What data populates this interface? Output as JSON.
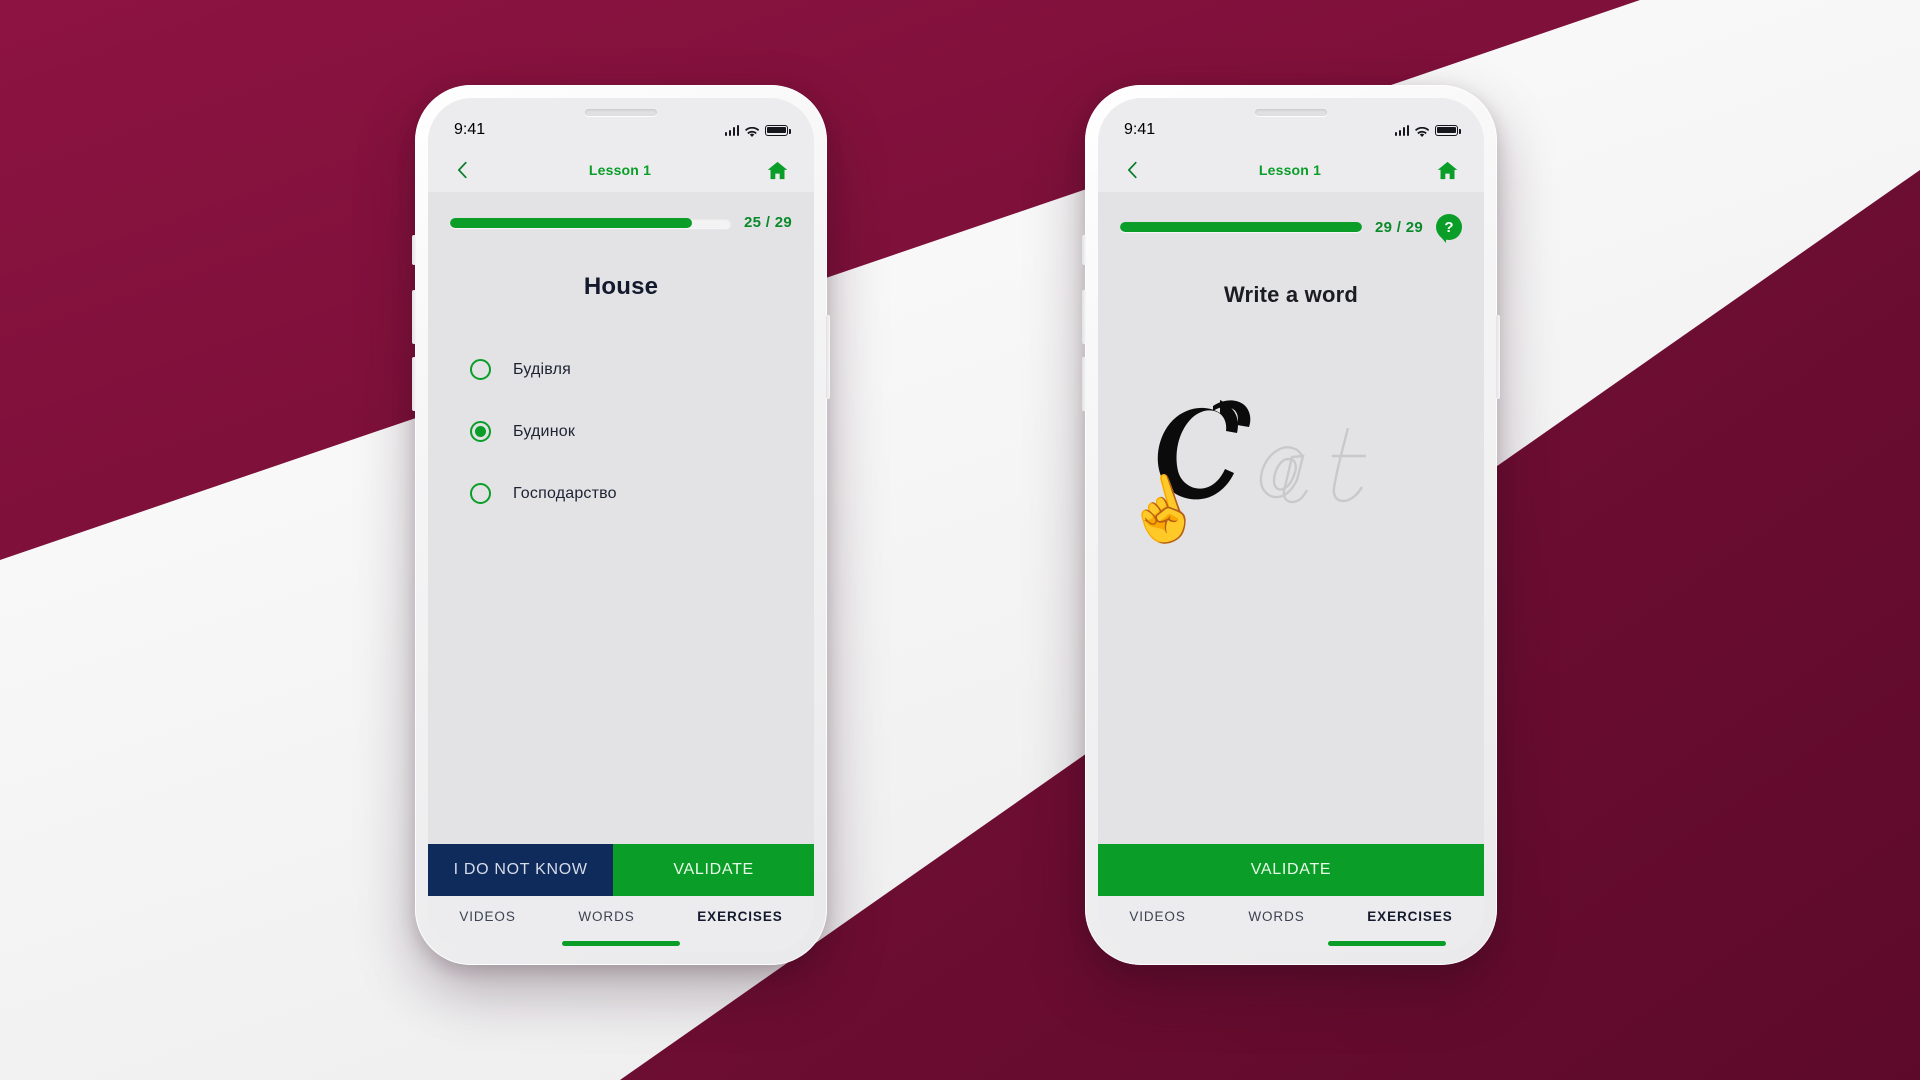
{
  "background": {
    "maroon": "#7c1039",
    "maroon_dark": "#6d0f33",
    "white": "#ffffff"
  },
  "theme": {
    "green": "#0a9e28",
    "green_text": "#0a8a2a",
    "navy": "#0f2b5b",
    "ink": "#141a2e",
    "screen_bg": "#e3e3e5",
    "chrome_bg": "#ececee"
  },
  "phones": [
    {
      "id": "phone-1",
      "status": {
        "time": "9:41",
        "signal_icon": "signal-bars-icon",
        "wifi_icon": "wifi-icon",
        "battery_icon": "battery-icon"
      },
      "nav": {
        "back_icon": "chevron-left-icon",
        "title": "Lesson 1",
        "home_icon": "home-icon"
      },
      "progress": {
        "current": 25,
        "total": 29,
        "label": "25 / 29",
        "percent": 86,
        "has_help": false
      },
      "prompt": "House",
      "prompt_style": "bold",
      "options": [
        {
          "label": "Будівля",
          "selected": false
        },
        {
          "label": "Будинок",
          "selected": true
        },
        {
          "label": "Господарство",
          "selected": false
        }
      ],
      "actions": [
        {
          "label": "I DO NOT KNOW",
          "style": "dark"
        },
        {
          "label": "VALIDATE",
          "style": "green"
        }
      ],
      "tabs": [
        {
          "label": "VIDEOS",
          "active": false
        },
        {
          "label": "WORDS",
          "active": false
        },
        {
          "label": "EXERCISES",
          "active": true
        }
      ],
      "home_indicator_align": "center"
    },
    {
      "id": "phone-2",
      "status": {
        "time": "9:41",
        "signal_icon": "signal-bars-icon",
        "wifi_icon": "wifi-icon",
        "battery_icon": "battery-icon"
      },
      "nav": {
        "back_icon": "chevron-left-icon",
        "title": "Lesson 1",
        "home_icon": "home-icon"
      },
      "progress": {
        "current": 29,
        "total": 29,
        "label": "29 / 29",
        "percent": 100,
        "has_help": true,
        "help_glyph": "?"
      },
      "prompt": "Write a word",
      "prompt_style": "light",
      "handwriting": {
        "word": "Cat",
        "traced_part": "C",
        "untraced_part": "at",
        "traced_color": "#0b0b0b",
        "outline_color": "#c9c9cc",
        "pointer_icon": "pointing-hand-icon",
        "pointer_glyph": "☝",
        "cuff_color": "#0a9e28"
      },
      "actions": [
        {
          "label": "VALIDATE",
          "style": "green"
        }
      ],
      "tabs": [
        {
          "label": "VIDEOS",
          "active": false
        },
        {
          "label": "WORDS",
          "active": false
        },
        {
          "label": "EXERCISES",
          "active": true
        }
      ],
      "home_indicator_align": "right"
    }
  ]
}
